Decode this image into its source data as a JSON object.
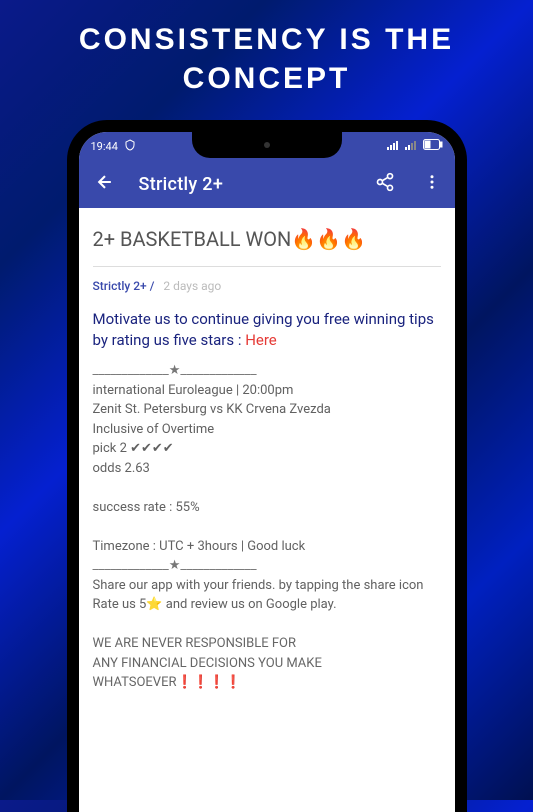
{
  "promo": {
    "line1": "CONSISTENCY IS THE",
    "line2": "CONCEPT"
  },
  "statusBar": {
    "time": "19:44"
  },
  "appBar": {
    "title": "Strictly 2+"
  },
  "post": {
    "headline": "2+ BASKETBALL WON🔥🔥🔥",
    "category": "Strictly 2+ /",
    "timeAgo": "2 days ago",
    "motivateText": "Motivate us to continue giving you free winning tips by rating us five stars : ",
    "motivateLink": "Here",
    "sepTop": "_____________★_____________",
    "league": "international Euroleague | 20:00pm",
    "match": "Zenit St. Petersburg vs KK Crvena Zvezda",
    "overtime": "Inclusive of Overtime",
    "pick": "pick 2 ✔✔✔✔",
    "odds": "odds 2.63",
    "success": "success rate : 55%",
    "timezone": "Timezone : UTC + 3hours | Good luck",
    "sepBottom": "_____________★_____________",
    "share1": "Share our app with your friends. by tapping the share icon",
    "share2": "Rate us 5⭐ and review us on Google play.",
    "disc1": "WE ARE NEVER RESPONSIBLE FOR",
    "disc2": "ANY FINANCIAL DECISIONS YOU MAKE WHATSOEVER❗❗❗❗"
  }
}
